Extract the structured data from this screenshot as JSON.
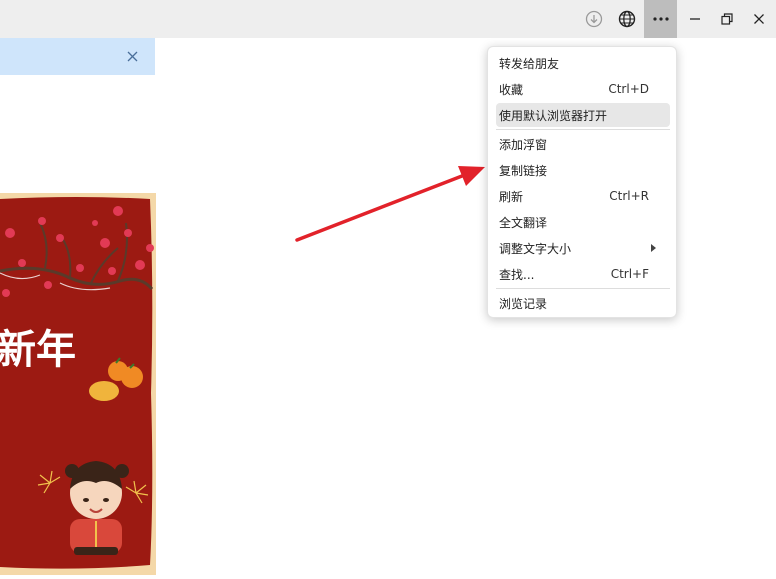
{
  "titlebar": {
    "icons": [
      "download-icon",
      "globe-icon",
      "more-icon",
      "minimize-icon",
      "restore-icon",
      "close-icon"
    ]
  },
  "notice": {
    "close_icon": "close-icon"
  },
  "card": {
    "title_fragment": "新年",
    "background_color": "#9c1a12"
  },
  "menu": {
    "items": [
      {
        "label": "转发给朋友",
        "shortcut": ""
      },
      {
        "label": "收藏",
        "shortcut": "Ctrl+D"
      },
      {
        "label": "使用默认浏览器打开",
        "shortcut": "",
        "highlighted": true
      },
      {
        "label": "添加浮窗",
        "shortcut": ""
      },
      {
        "label": "复制链接",
        "shortcut": ""
      },
      {
        "label": "刷新",
        "shortcut": "Ctrl+R"
      },
      {
        "label": "全文翻译",
        "shortcut": ""
      },
      {
        "label": "调整文字大小",
        "shortcut": "",
        "submenu": true
      },
      {
        "label": "查找...",
        "shortcut": "Ctrl+F"
      },
      {
        "label": "浏览记录",
        "shortcut": ""
      }
    ]
  },
  "colors": {
    "accent_arrow": "#e2222a",
    "highlight": "#e7e7e7",
    "titlebar": "#eeeeee",
    "notice": "#cfe5fb"
  }
}
